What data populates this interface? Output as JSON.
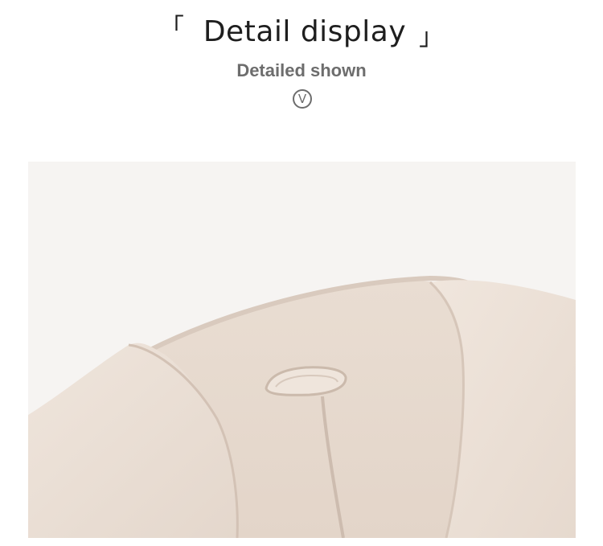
{
  "header": {
    "bracket_open": "「",
    "title": "Detail display",
    "bracket_close": "」",
    "subtitle": "Detailed shown",
    "badge_letter": "V"
  },
  "photo": {
    "subject": "cream wool coat collar detail",
    "colors": {
      "background": "#f6f4f2",
      "fabric_light": "#ede2d8",
      "fabric_mid": "#e4d6ca",
      "fabric_shadow": "#d3c3b6"
    }
  }
}
